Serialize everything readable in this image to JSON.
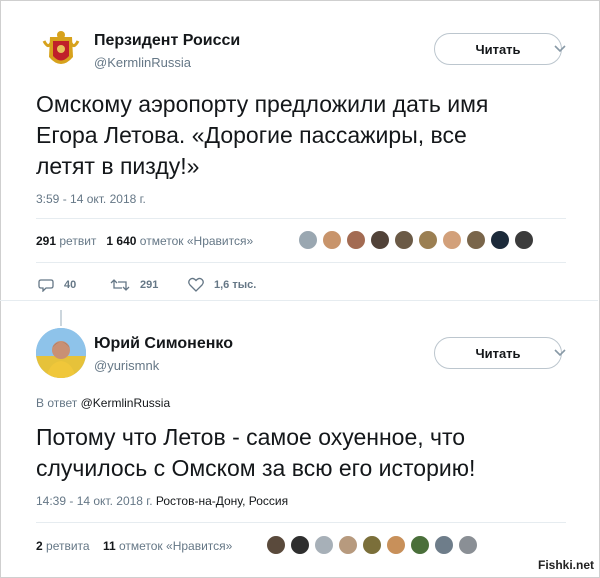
{
  "tweet1": {
    "name": "Перзидент Роисси",
    "handle": "@KermlinRussia",
    "follow_label": "Читать",
    "text_line1": "Омскому аэропорту предложили дать имя",
    "text_line2": "Егора Летова. «Дорогие пассажиры, все",
    "text_line3": "летят в пизду!»",
    "timestamp": "3:59 - 14 окт. 2018 г.",
    "retweets_count": "291",
    "retweets_label": "ретвит",
    "likes_count": "1 640",
    "likes_label": "отметок «Нравится»",
    "actions": {
      "reply_count": "40",
      "retweet_count": "291",
      "like_count": "1,6 тыс."
    }
  },
  "tweet2": {
    "name": "Юрий Симоненко",
    "handle": "@yurismnk",
    "follow_label": "Читать",
    "reply_prefix": "В ответ",
    "reply_handle": "@KermlinRussia",
    "text_line1": "Потому что Летов - самое охуенное, что",
    "text_line2": "случилось с Омском за всю его историю!",
    "timestamp": "14:39 - 14 окт. 2018 г.",
    "location": "Ростов-на-Дону, Россия",
    "retweets_count": "2",
    "retweets_label": "ретвита",
    "likes_count": "11",
    "likes_label": "отметок «Нравится»"
  },
  "watermark": "Fishki.net",
  "colors": {
    "text": "#14171a",
    "muted": "#657786",
    "border": "#e6ecf0"
  }
}
